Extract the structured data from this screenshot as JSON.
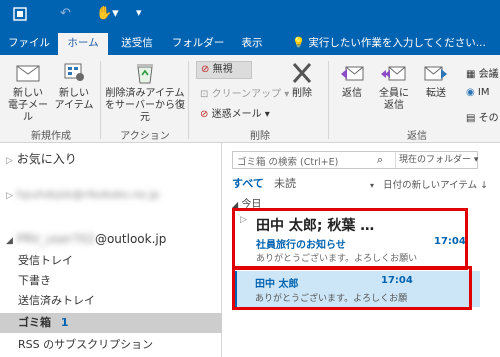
{
  "titlebar": {
    "icons": [
      "outlook-icon",
      "undo-icon",
      "touch-mode-icon"
    ]
  },
  "tabs": [
    {
      "label": "ファイル",
      "active": false
    },
    {
      "label": "ホーム",
      "active": true
    },
    {
      "label": "送受信",
      "active": false
    },
    {
      "label": "フォルダー",
      "active": false
    },
    {
      "label": "表示",
      "active": false
    }
  ],
  "tellme": "実行したい作業を入力してください...",
  "ribbon": {
    "new_email": "新しい\n電子メール",
    "new_items": "新しい\nアイテム",
    "cleanup": "削除済みアイテム\nをサーバーから復元",
    "ignore": "無視",
    "cleanup_menu": "クリーンアップ",
    "junk": "迷惑メール",
    "delete": "削除",
    "reply": "返信",
    "reply_all": "全員に\n返信",
    "forward": "転送",
    "meeting": "会議",
    "im": "IM",
    "more": "その",
    "group_new": "新規作成",
    "group_action": "アクション",
    "group_delete": "削除",
    "group_respond": "返信"
  },
  "folders": {
    "favorites": "お気に入り",
    "account_blurred": "hpuhdsjsk@rikokoko.ne.jp",
    "account_prefix_blurred": "PRV_user702",
    "account_domain": "@outlook.jp",
    "items": [
      {
        "label": "受信トレイ",
        "count": ""
      },
      {
        "label": "下書き",
        "count": ""
      },
      {
        "label": "送信済みトレイ",
        "count": ""
      },
      {
        "label": "ゴミ箱",
        "count": "1",
        "selected": true
      },
      {
        "label": "RSS のサブスクリプション",
        "count": ""
      }
    ]
  },
  "msglist": {
    "search_placeholder": "ゴミ箱 の検索 (Ctrl+E)",
    "scope": "現在のフォルダー",
    "filter_all": "すべて",
    "filter_unread": "未読",
    "sort": "日付の新しいアイテム",
    "group_today": "今日",
    "thread": {
      "from": "田中 太郎;  秋葉 …",
      "subject": "社員旅行のお知らせ",
      "time": "17:04",
      "preview": "ありがとうございます。よろしくお願い"
    },
    "child": {
      "from": "田中 太郎",
      "time": "17:04",
      "preview": "ありがとうございます。よろしくお願"
    }
  },
  "colors": {
    "accent": "#0063b1",
    "highlight": "#cde6f7",
    "annotation": "#e00000"
  }
}
